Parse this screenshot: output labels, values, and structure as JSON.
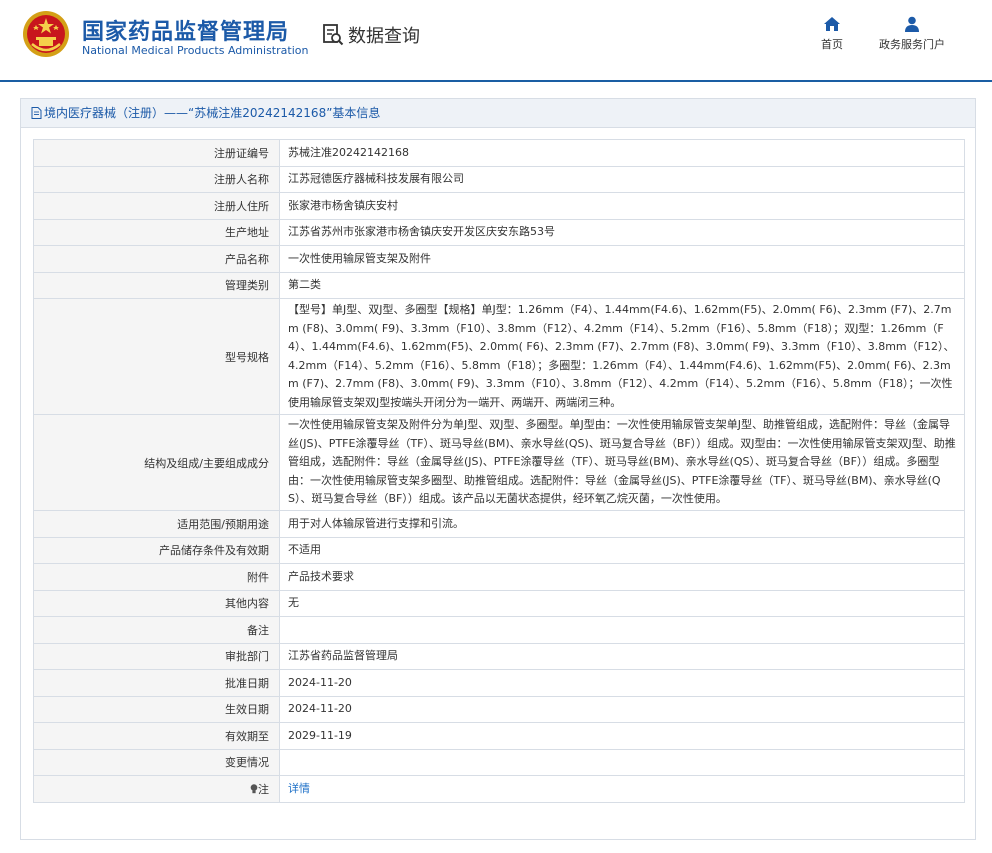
{
  "header": {
    "brand_cn": "国家药品监督管理局",
    "brand_en": "National Medical Products Administration",
    "query_label": "数据查询",
    "nav": {
      "home_label": "首页",
      "portal_label": "政务服务门户"
    },
    "brand_color": "#1c5aa8"
  },
  "panel": {
    "title": "境内医疗器械（注册）——“苏械注准20242142168”基本信息"
  },
  "rows": [
    {
      "label": "注册证编号",
      "value": "苏械注准20242142168"
    },
    {
      "label": "注册人名称",
      "value": "江苏冠德医疗器械科技发展有限公司"
    },
    {
      "label": "注册人住所",
      "value": "张家港市杨舍镇庆安村"
    },
    {
      "label": "生产地址",
      "value": "江苏省苏州市张家港市杨舍镇庆安开发区庆安东路53号"
    },
    {
      "label": "产品名称",
      "value": "一次性使用输尿管支架及附件"
    },
    {
      "label": "管理类别",
      "value": "第二类"
    },
    {
      "label": "型号规格",
      "value": "【型号】单J型、双J型、多圈型【规格】单J型：1.26mm（F4）、1.44mm(F4.6)、1.62mm(F5)、2.0mm( F6)、2.3mm (F7)、2.7mm (F8)、3.0mm( F9)、3.3mm（F10）、3.8mm（F12）、4.2mm（F14）、5.2mm（F16）、5.8mm（F18）；双J型：1.26mm（F4）、1.44mm(F4.6)、1.62mm(F5)、2.0mm( F6)、2.3mm (F7)、2.7mm (F8)、3.0mm( F9)、3.3mm（F10）、3.8mm（F12）、4.2mm（F14）、5.2mm（F16）、5.8mm（F18）；多圈型：1.26mm（F4）、1.44mm(F4.6)、1.62mm(F5)、2.0mm( F6)、2.3mm (F7)、2.7mm (F8)、3.0mm( F9)、3.3mm（F10）、3.8mm（F12）、4.2mm（F14）、5.2mm（F16）、5.8mm（F18）；一次性使用输尿管支架双J型按端头开闭分为一端开、两端开、两端闭三种。"
    },
    {
      "label": "结构及组成/主要组成成分",
      "value": "一次性使用输尿管支架及附件分为单J型、双J型、多圈型。单J型由：一次性使用输尿管支架单J型、助推管组成，选配附件：导丝（金属导丝(JS)、PTFE涂覆导丝（TF）、斑马导丝(BM)、亲水导丝(QS)、斑马复合导丝（BF））组成。双J型由：一次性使用输尿管支架双J型、助推管组成，选配附件：导丝（金属导丝(JS)、PTFE涂覆导丝（TF）、斑马导丝(BM)、亲水导丝(QS）、斑马复合导丝（BF））组成。多圈型由：一次性使用输尿管支架多圈型、助推管组成。选配附件：导丝（金属导丝(JS)、PTFE涂覆导丝（TF）、斑马导丝(BM)、亲水导丝(QS）、斑马复合导丝（BF））组成。该产品以无菌状态提供，经环氧乙烷灭菌，一次性使用。"
    },
    {
      "label": "适用范围/预期用途",
      "value": "用于对人体输尿管进行支撑和引流。"
    },
    {
      "label": "产品储存条件及有效期",
      "value": "不适用"
    },
    {
      "label": "附件",
      "value": "产品技术要求"
    },
    {
      "label": "其他内容",
      "value": "无"
    },
    {
      "label": "备注",
      "value": ""
    },
    {
      "label": "审批部门",
      "value": "江苏省药品监督管理局"
    },
    {
      "label": "批准日期",
      "value": "2024-11-20"
    },
    {
      "label": "生效日期",
      "value": "2024-11-20"
    },
    {
      "label": "有效期至",
      "value": "2029-11-19"
    },
    {
      "label": "变更情况",
      "value": ""
    },
    {
      "label": "注",
      "value": "详情",
      "label_icon": "bulb-icon"
    }
  ]
}
